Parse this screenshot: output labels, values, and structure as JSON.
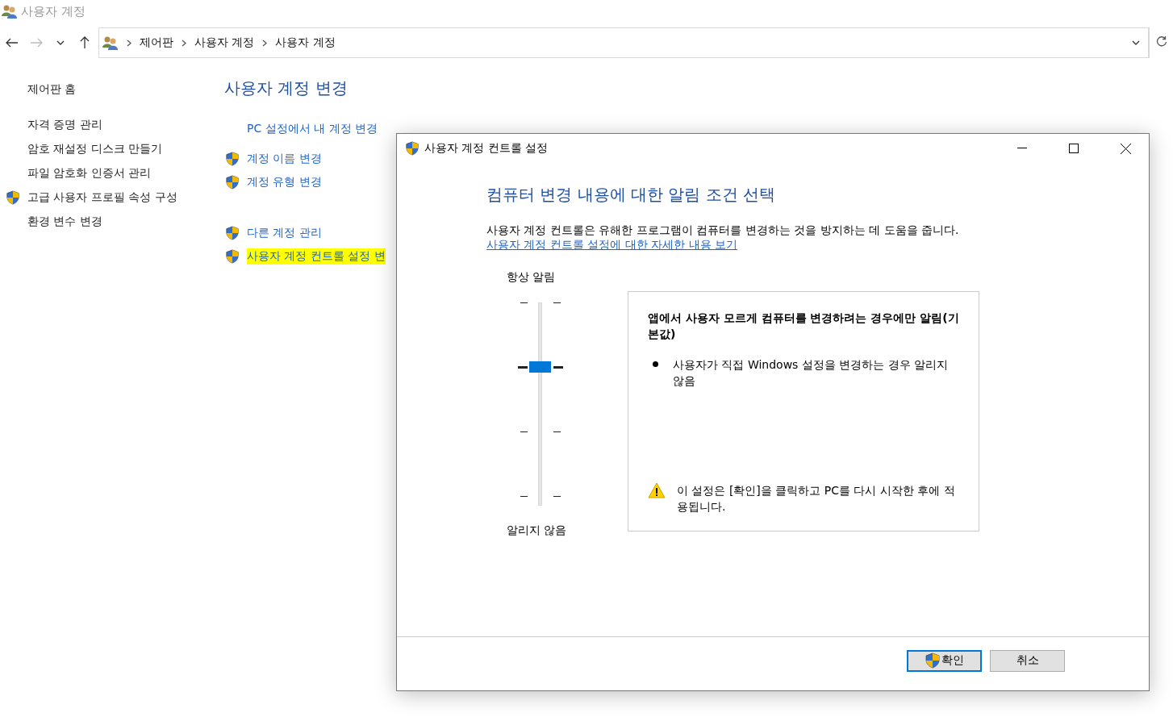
{
  "window": {
    "title": "사용자 계정"
  },
  "address_bar": {
    "breadcrumbs": [
      "제어판",
      "사용자 계정",
      "사용자 계정"
    ]
  },
  "sidebar": {
    "items": [
      {
        "label": "제어판 홈",
        "shield": false
      },
      {
        "label": "자격 증명 관리",
        "shield": false
      },
      {
        "label": "암호 재설정 디스크 만들기",
        "shield": false
      },
      {
        "label": "파일 암호화 인증서 관리",
        "shield": false
      },
      {
        "label": "고급 사용자 프로필 속성 구성",
        "shield": true
      },
      {
        "label": "환경 변수 변경",
        "shield": false
      }
    ]
  },
  "main": {
    "heading": "사용자 계정 변경",
    "links": [
      {
        "label": "PC 설정에서 내 계정 변경",
        "shield": false,
        "highlighted": false
      },
      {
        "label": "계정 이름 변경",
        "shield": true,
        "highlighted": false
      },
      {
        "label": "계정 유형 변경",
        "shield": true,
        "highlighted": false
      },
      {
        "label": "다른 계정 관리",
        "shield": true,
        "highlighted": false
      },
      {
        "label": "사용자 계정 컨트롤 설정 변",
        "shield": true,
        "highlighted": true
      }
    ]
  },
  "dialog": {
    "title": "사용자 계정 컨트롤 설정",
    "heading": "컴퓨터 변경 내용에 대한 알림 조건 선택",
    "description": "사용자 계정 컨트롤은 유해한 프로그램이 컴퓨터를 변경하는 것을 방지하는 데 도움을 줍니다.",
    "more_link": "사용자 계정 컨트롤 설정에 대한 자세한 내용 보기",
    "slider": {
      "top_label": "항상 알림",
      "bottom_label": "알리지 않음",
      "level": 0.667
    },
    "info": {
      "title": "앱에서 사용자 모르게 컴퓨터를 변경하려는 경우에만 알림(기본값)",
      "bullets": [
        "사용자가 직접 Windows 설정을 변경하는 경우 알리지 않음"
      ],
      "warning": "이 설정은 [확인]을 클릭하고 PC를 다시 시작한 후에 적용됩니다."
    },
    "buttons": [
      {
        "label": "확인",
        "shield": true,
        "default": true
      },
      {
        "label": "취소",
        "shield": false,
        "default": false
      }
    ]
  }
}
